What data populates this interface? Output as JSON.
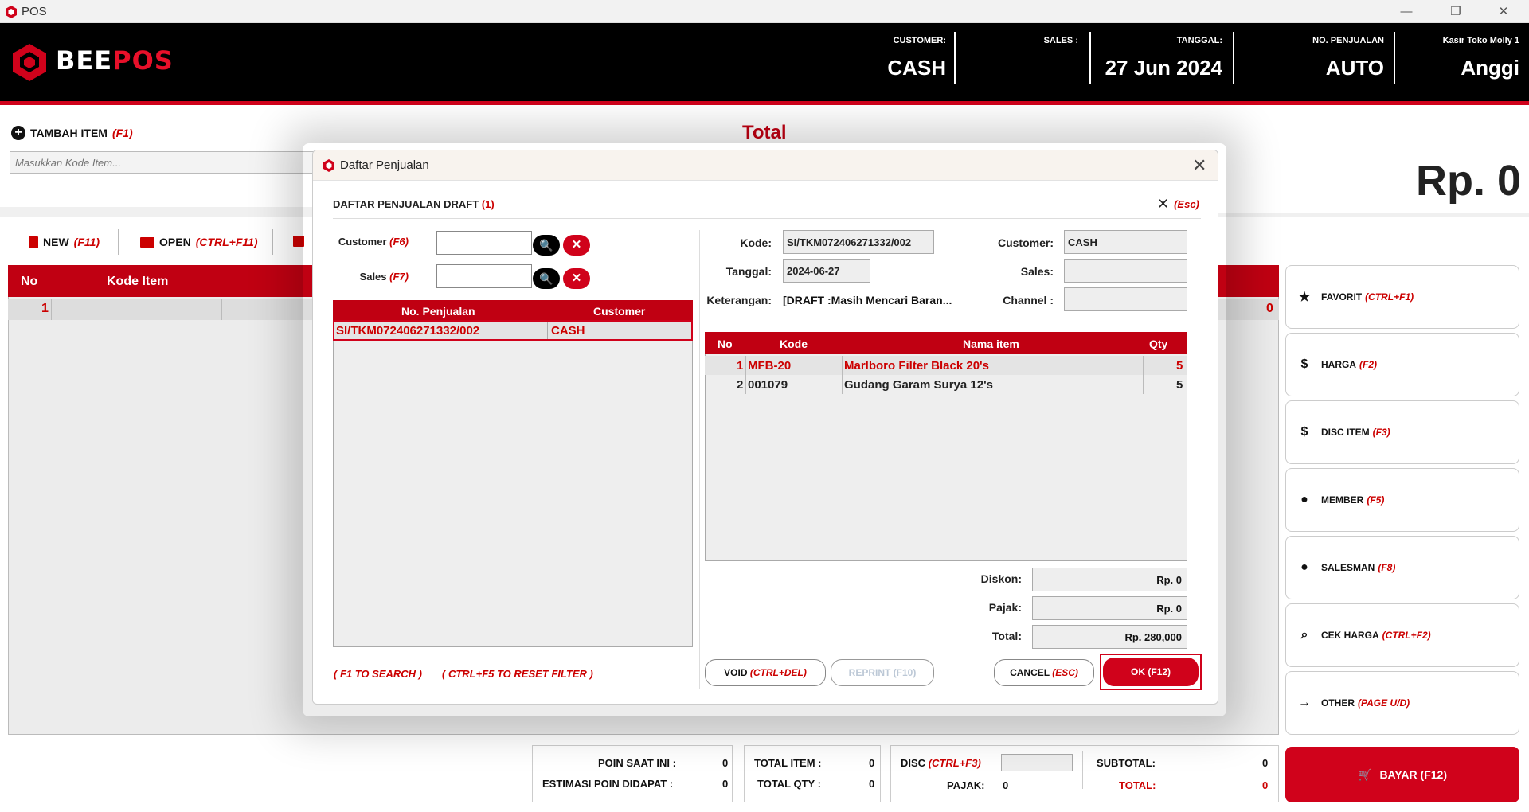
{
  "window": {
    "title": "POS"
  },
  "brand": {
    "name_part1": "BEE",
    "name_part2": "POS"
  },
  "header": {
    "customer_label": "CUSTOMER:",
    "customer_value": "CASH",
    "sales_label": "SALES :",
    "sales_value": "",
    "tanggal_label": "TANGGAL:",
    "tanggal_value": "27 Jun 2024",
    "no_label": "NO. PENJUALAN",
    "no_value": "AUTO",
    "kasir_label": "Kasir Toko Molly 1",
    "kasir_value": "Anggi"
  },
  "main": {
    "tambah_label": "TAMBAH ITEM",
    "tambah_key": "(F1)",
    "kode_placeholder": "Masukkan Kode Item...",
    "total_title": "Total",
    "total_value": "Rp. 0",
    "toolbar": {
      "new_label": "NEW",
      "new_key": "(F11)",
      "open_label": "OPEN",
      "open_key": "(CTRL+F11)"
    },
    "grid": {
      "col_no": "No",
      "col_kode": "Kode Item",
      "row_no": "1",
      "row_value": "0"
    }
  },
  "sidebar": {
    "items": [
      {
        "label": "FAVORIT",
        "key": "(CTRL+F1)",
        "icon": "star-icon"
      },
      {
        "label": "HARGA",
        "key": "(F2)",
        "icon": "price-tag-icon"
      },
      {
        "label": "DISC ITEM",
        "key": "(F3)",
        "icon": "discount-icon"
      },
      {
        "label": "MEMBER",
        "key": "(F5)",
        "icon": "person-icon"
      },
      {
        "label": "SALESMAN",
        "key": "(F8)",
        "icon": "salesman-icon"
      },
      {
        "label": "CEK HARGA",
        "key": "(CTRL+F2)",
        "icon": "search-icon"
      },
      {
        "label": "OTHER",
        "key": "(PAGE U/D)",
        "icon": "arrow-right-icon"
      }
    ],
    "bayar_label": "BAYAR (F12)"
  },
  "footer": {
    "poin_label": "POIN SAAT INI :",
    "poin_value": "0",
    "estimasi_label": "ESTIMASI POIN DIDAPAT :",
    "estimasi_value": "0",
    "total_item_label": "TOTAL ITEM :",
    "total_item_value": "0",
    "total_qty_label": "TOTAL QTY :",
    "total_qty_value": "0",
    "disc_label": "DISC",
    "disc_key": "(CTRL+F3)",
    "pajak_label": "PAJAK:",
    "pajak_value": "0",
    "subtotal_label": "SUBTOTAL:",
    "subtotal_value": "0",
    "total_label": "TOTAL:",
    "total_value": "0"
  },
  "modal": {
    "title": "Daftar Penjualan",
    "heading": "DAFTAR PENJUALAN DRAFT",
    "count": "(1)",
    "esc_label": "(Esc)",
    "filter": {
      "customer_label": "Customer",
      "customer_key": "(F6)",
      "sales_label": "Sales",
      "sales_key": "(F7)"
    },
    "list": {
      "col_no": "No. Penjualan",
      "col_customer": "Customer",
      "rows": [
        {
          "no": "SI/TKM072406271332/002",
          "customer": "CASH"
        }
      ]
    },
    "hints": {
      "search": "( F1 TO SEARCH )",
      "reset": "( CTRL+F5 TO RESET FILTER )"
    },
    "detail": {
      "kode_label": "Kode:",
      "kode_value": "SI/TKM072406271332/002",
      "tanggal_label": "Tanggal:",
      "tanggal_value": "2024-06-27",
      "keterangan_label": "Keterangan:",
      "keterangan_value": "[DRAFT :Masih Mencari Baran...",
      "customer_label": "Customer:",
      "customer_value": "CASH",
      "sales_label": "Sales:",
      "sales_value": "",
      "channel_label": "Channel :",
      "channel_value": ""
    },
    "items": {
      "col_no": "No",
      "col_kode": "Kode",
      "col_nama": "Nama item",
      "col_qty": "Qty",
      "rows": [
        {
          "no": "1",
          "kode": "MFB-20",
          "nama": "Marlboro Filter Black 20's",
          "qty": "5"
        },
        {
          "no": "2",
          "kode": "001079",
          "nama": "Gudang Garam Surya 12's",
          "qty": "5"
        }
      ]
    },
    "summary": {
      "diskon_label": "Diskon:",
      "diskon_value": "Rp. 0",
      "pajak_label": "Pajak:",
      "pajak_value": "Rp. 0",
      "total_label": "Total:",
      "total_value": "Rp. 280,000"
    },
    "buttons": {
      "void_label": "VOID",
      "void_key": "(CTRL+DEL)",
      "reprint_label": "REPRINT (F10)",
      "cancel_label": "CANCEL",
      "cancel_key": "(ESC)",
      "ok_label": "OK (F12)"
    }
  },
  "colors": {
    "accent": "#d0021b",
    "header_bg": "#000000"
  }
}
